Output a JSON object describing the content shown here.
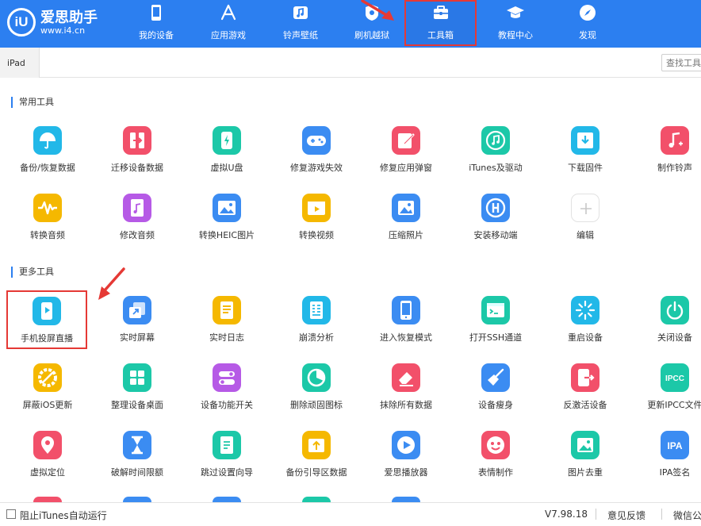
{
  "app": {
    "logo_mark": "iU",
    "name": "爱思助手",
    "url": "www.i4.cn"
  },
  "nav": [
    {
      "label": "我的设备",
      "icon": "phone-icon"
    },
    {
      "label": "应用游戏",
      "icon": "app-store-icon"
    },
    {
      "label": "铃声壁纸",
      "icon": "music-icon"
    },
    {
      "label": "刷机越狱",
      "icon": "flash-icon"
    },
    {
      "label": "工具箱",
      "icon": "toolbox-icon",
      "active": true
    },
    {
      "label": "教程中心",
      "icon": "graduation-cap-icon"
    },
    {
      "label": "发现",
      "icon": "compass-icon"
    }
  ],
  "device_tab": "iPad",
  "search": {
    "placeholder": "查找工具"
  },
  "sections": {
    "common_title": "常用工具",
    "more_title": "更多工具"
  },
  "common_tools": [
    {
      "label": "备份/恢复数据",
      "icon": "umbrella-icon",
      "color": "#22b8e8"
    },
    {
      "label": "迁移设备数据",
      "icon": "transfer-icon",
      "color": "#f2506a"
    },
    {
      "label": "虚拟U盘",
      "icon": "usb-drive-icon",
      "color": "#1cc8a8"
    },
    {
      "label": "修复游戏失效",
      "icon": "gamepad-icon",
      "color": "#3b8cf2"
    },
    {
      "label": "修复应用弹窗",
      "icon": "repair-icon",
      "color": "#f2506a"
    },
    {
      "label": "iTunes及驱动",
      "icon": "itunes-icon",
      "color": "#1cc8a8"
    },
    {
      "label": "下载固件",
      "icon": "download-icon",
      "color": "#22b8e8"
    },
    {
      "label": "制作铃声",
      "icon": "music-note-icon",
      "color": "#f2506a"
    },
    {
      "label": "转换音频",
      "icon": "waveform-icon",
      "color": "#f5b800"
    },
    {
      "label": "修改音频",
      "icon": "audio-file-icon",
      "color": "#b65ae6"
    },
    {
      "label": "转换HEIC图片",
      "icon": "image-convert-icon",
      "color": "#3b8cf2"
    },
    {
      "label": "转换视频",
      "icon": "video-convert-icon",
      "color": "#f5b800"
    },
    {
      "label": "压缩照片",
      "icon": "photo-icon",
      "color": "#3b8cf2"
    },
    {
      "label": "安装移动端",
      "icon": "i4-mobile-icon",
      "color": "#3b8cf2"
    },
    {
      "label": "编辑",
      "icon": "plus-icon",
      "color": "#ffffff"
    }
  ],
  "more_tools": [
    {
      "label": "手机投屏直播",
      "icon": "screen-cast-icon",
      "color": "#22b8e8"
    },
    {
      "label": "实时屏幕",
      "icon": "live-screen-icon",
      "color": "#3b8cf2"
    },
    {
      "label": "实时日志",
      "icon": "log-icon",
      "color": "#f5b800"
    },
    {
      "label": "崩溃分析",
      "icon": "crash-report-icon",
      "color": "#22b8e8"
    },
    {
      "label": "进入恢复模式",
      "icon": "recovery-mode-icon",
      "color": "#3b8cf2"
    },
    {
      "label": "打开SSH通道",
      "icon": "terminal-icon",
      "color": "#1cc8a8"
    },
    {
      "label": "重启设备",
      "icon": "restart-icon",
      "color": "#22b8e8"
    },
    {
      "label": "关闭设备",
      "icon": "power-icon",
      "color": "#1cc8a8"
    },
    {
      "label": "屏蔽iOS更新",
      "icon": "block-update-icon",
      "color": "#f5b800"
    },
    {
      "label": "整理设备桌面",
      "icon": "grid-icon",
      "color": "#1cc8a8"
    },
    {
      "label": "设备功能开关",
      "icon": "toggle-icon",
      "color": "#b65ae6"
    },
    {
      "label": "删除顽固图标",
      "icon": "pie-icon",
      "color": "#1cc8a8"
    },
    {
      "label": "抹除所有数据",
      "icon": "eraser-icon",
      "color": "#f2506a"
    },
    {
      "label": "设备瘦身",
      "icon": "broom-icon",
      "color": "#3b8cf2"
    },
    {
      "label": "反激活设备",
      "icon": "deactivate-icon",
      "color": "#f2506a"
    },
    {
      "label": "更新IPCC文件",
      "icon": "ipcc-icon",
      "color": "#1cc8a8"
    },
    {
      "label": "虚拟定位",
      "icon": "location-pin-icon",
      "color": "#f2506a"
    },
    {
      "label": "破解时间限额",
      "icon": "hourglass-icon",
      "color": "#3b8cf2"
    },
    {
      "label": "跳过设置向导",
      "icon": "skip-setup-icon",
      "color": "#1cc8a8"
    },
    {
      "label": "备份引导区数据",
      "icon": "backup-boot-icon",
      "color": "#f5b800"
    },
    {
      "label": "爱思播放器",
      "icon": "play-icon",
      "color": "#3b8cf2"
    },
    {
      "label": "表情制作",
      "icon": "emoji-icon",
      "color": "#f2506a"
    },
    {
      "label": "图片去重",
      "icon": "image-dedupe-icon",
      "color": "#1cc8a8"
    },
    {
      "label": "IPA签名",
      "icon": "ipa-icon",
      "color": "#3b8cf2"
    }
  ],
  "footer": {
    "itunes_checkbox": "阻止iTunes自动运行",
    "version": "V7.98.18",
    "feedback": "意见反馈",
    "wechat": "微信公"
  },
  "colors": {
    "topbar": "#2c7ff0",
    "highlight_border": "#e53935"
  }
}
